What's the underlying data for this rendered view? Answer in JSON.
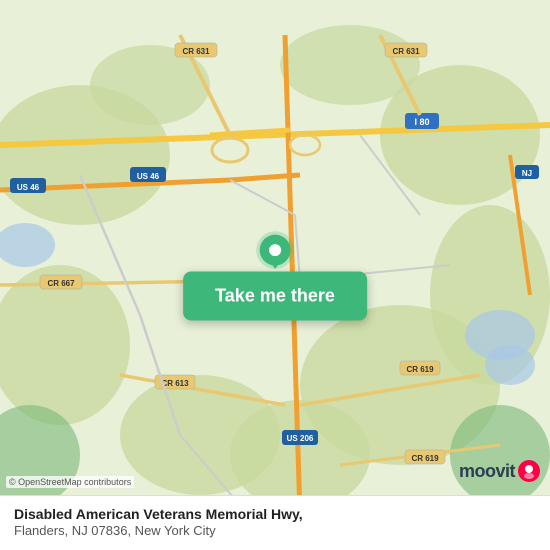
{
  "map": {
    "background_color": "#e8f0d8",
    "attribution": "© OpenStreetMap contributors"
  },
  "cta": {
    "button_label": "Take me there"
  },
  "location": {
    "name": "Disabled American Veterans Memorial Hwy,",
    "sub": "Flanders, NJ 07836, New York City"
  },
  "moovit": {
    "text": "moovit"
  },
  "icons": {
    "pin": "map-pin-icon",
    "moovit_dot": "moovit-logo-icon"
  }
}
